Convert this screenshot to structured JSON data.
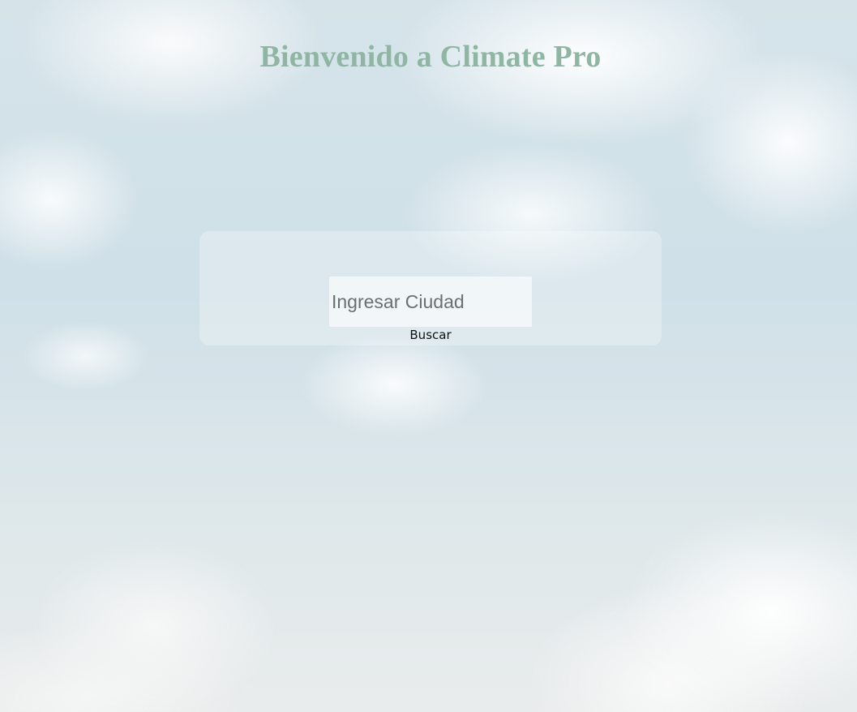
{
  "header": {
    "title": "Bienvenido a Climate Pro"
  },
  "search": {
    "value": "",
    "placeholder": "Ingresar Ciudad",
    "button_label": "Buscar"
  },
  "colors": {
    "title": "#8fb6a3",
    "sky": "#cfe0e8"
  }
}
